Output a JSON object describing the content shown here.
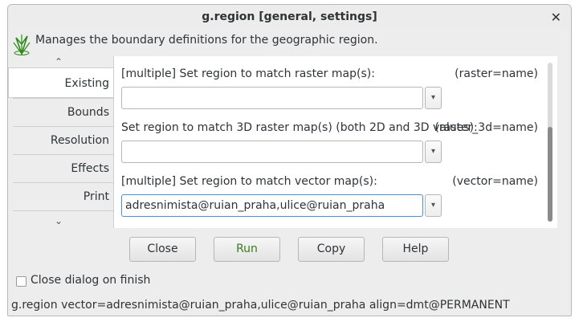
{
  "window": {
    "title": "g.region [general, settings]",
    "close_glyph": "✕"
  },
  "description": "Manages the boundary definitions for the geographic region.",
  "tabs": [
    {
      "label": "Existing",
      "active": true
    },
    {
      "label": "Bounds",
      "active": false
    },
    {
      "label": "Resolution",
      "active": false
    },
    {
      "label": "Effects",
      "active": false
    },
    {
      "label": "Print",
      "active": false
    }
  ],
  "params": {
    "raster": {
      "label": "[multiple] Set region to match raster map(s):",
      "key": "(raster=name)",
      "value": ""
    },
    "raster_3d": {
      "label": "Set region to match 3D raster map(s) (both 2D and 3D values):",
      "key": "(raster_3d=name)",
      "value": ""
    },
    "vector": {
      "label": "[multiple] Set region to match vector map(s):",
      "key": "(vector=name)",
      "value": "adresnimista@ruian_praha,ulice@ruian_praha"
    }
  },
  "buttons": {
    "close": "Close",
    "run": "Run",
    "copy": "Copy",
    "help": "Help"
  },
  "close_on_finish": {
    "label": "Close dialog on finish",
    "checked": false
  },
  "status_command": "g.region vector=adresnimista@ruian_praha,ulice@ruian_praha align=dmt@PERMANENT",
  "icons": {
    "dropdown": "▾",
    "scroll_up": "▲",
    "scroll_down": "▼"
  },
  "colors": {
    "run_text": "#3b7a1b",
    "focus_border": "#4a90d9",
    "grass_green": "#2f8a1a"
  }
}
